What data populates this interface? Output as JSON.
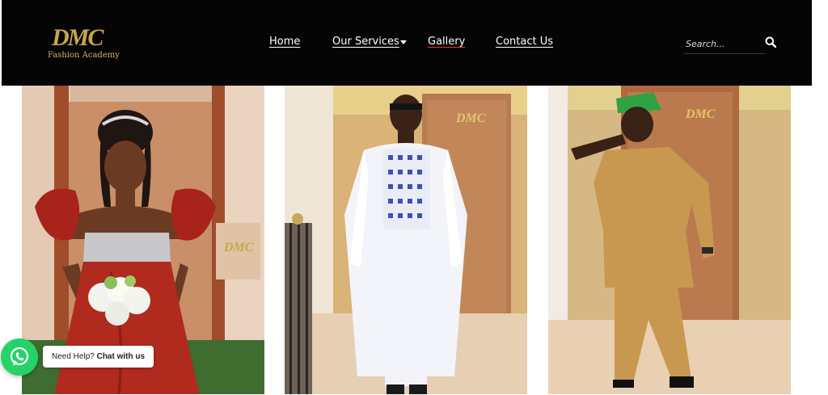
{
  "brand": {
    "mark": "DMC",
    "subtitle": "Fashion Academy"
  },
  "nav": {
    "items": [
      {
        "label": "Home",
        "active": false
      },
      {
        "label": "Our Services",
        "active": false,
        "has_dropdown": true
      },
      {
        "label": "Gallery",
        "active": true
      },
      {
        "label": "Contact Us",
        "active": false
      }
    ]
  },
  "search": {
    "placeholder": "Search...",
    "icon": "search-icon"
  },
  "gallery": {
    "photos": [
      {
        "subject": "woman-red-gown"
      },
      {
        "subject": "man-white-agbada"
      },
      {
        "subject": "man-tan-outfit-green-cap"
      }
    ],
    "watermark": "DMC"
  },
  "chat": {
    "prefix": "Need Help? ",
    "action": "Chat with us",
    "icon": "whatsapp-icon"
  },
  "colors": {
    "header_bg": "#050505",
    "brand_gold": "#c9a646",
    "active_underline": "#e23a3a",
    "whatsapp_green": "#25d366"
  }
}
